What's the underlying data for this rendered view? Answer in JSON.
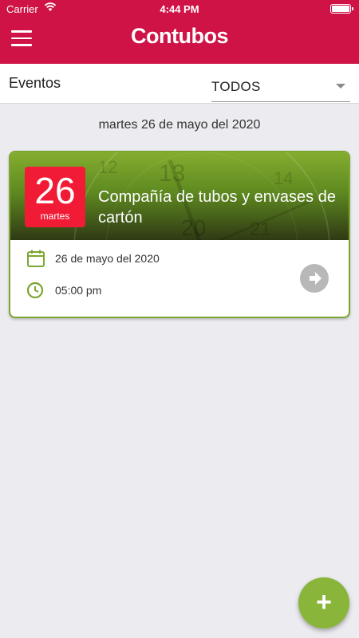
{
  "status_bar": {
    "carrier": "Carrier",
    "time": "4:44 PM"
  },
  "header": {
    "logo_text": "Contubos",
    "brand_color": "#cf1346"
  },
  "filter": {
    "label": "Eventos",
    "selected": "TODOS"
  },
  "date_heading": "martes 26 de mayo del 2020",
  "events": [
    {
      "day": "26",
      "weekday": "martes",
      "title": "Compañía de tubos y envases de cartón",
      "date": "26 de mayo del 2020",
      "time": "05:00 pm"
    }
  ],
  "fab": {
    "label": "+"
  },
  "colors": {
    "accent_green": "#7ba62f",
    "badge_red": "#f21b35"
  }
}
